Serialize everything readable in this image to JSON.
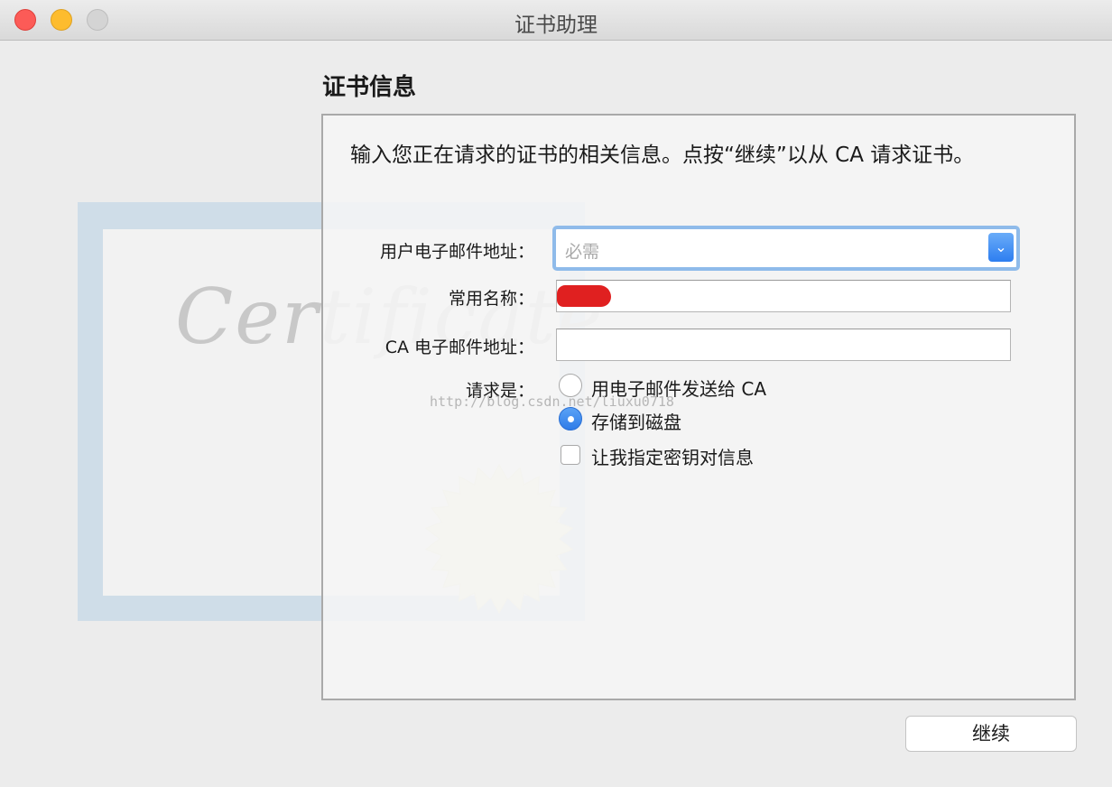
{
  "window": {
    "title": "证书助理",
    "traffic_lights": [
      "close",
      "minimize",
      "zoom"
    ]
  },
  "background": {
    "certificate_word": "Certificate",
    "seal_color": "#f4f2d4"
  },
  "section": {
    "title": "证书信息",
    "intro": "输入您正在请求的证书的相关信息。点按“继续”以从 CA 请求证书。"
  },
  "form": {
    "email_label": "用户电子邮件地址：",
    "email_placeholder": "必需",
    "email_value": "",
    "common_name_label": "常用名称：",
    "common_name_value_redacted": true,
    "ca_email_label": "CA 电子邮件地址：",
    "ca_email_value": "",
    "request_label": "请求是：",
    "options": [
      {
        "label": "用电子邮件发送给 CA",
        "selected": false
      },
      {
        "label": "存储到磁盘",
        "selected": true
      }
    ],
    "checkbox_label": "让我指定密钥对信息",
    "checkbox_checked": false
  },
  "watermark": "http://blog.csdn.net/liuxu0718",
  "buttons": {
    "continue_label": "继续"
  },
  "colors": {
    "accent": "#2f7ce8",
    "focus_ring": "#8fbbea",
    "redaction": "#e02020"
  }
}
